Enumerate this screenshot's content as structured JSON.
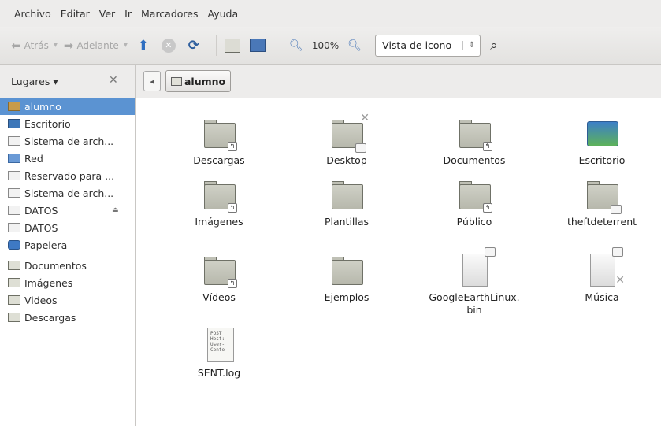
{
  "menubar": {
    "items": [
      {
        "label": "Archivo"
      },
      {
        "label": "Editar"
      },
      {
        "label": "Ver"
      },
      {
        "label": "Ir"
      },
      {
        "label": "Marcadores"
      },
      {
        "label": "Ayuda"
      }
    ]
  },
  "toolbar": {
    "back_label": "Atrás",
    "forward_label": "Adelante",
    "zoom_level": "100%",
    "view_mode": "Vista de icono",
    "icons": [
      "back-icon",
      "forward-icon",
      "up-icon",
      "stop-icon",
      "reload-icon",
      "home-icon",
      "computer-icon",
      "zoom-out-icon",
      "zoom-in-icon",
      "search-icon"
    ]
  },
  "sidebar": {
    "header_label": "Lugares",
    "items": [
      {
        "label": "alumno",
        "icon": "home-icon",
        "selected": true
      },
      {
        "label": "Escritorio",
        "icon": "desktop-icon"
      },
      {
        "label": "Sistema de arch...",
        "icon": "drive-icon"
      },
      {
        "label": "Red",
        "icon": "network-icon"
      },
      {
        "label": "Reservado para ...",
        "icon": "drive-icon"
      },
      {
        "label": "Sistema de arch...",
        "icon": "drive-icon"
      },
      {
        "label": "DATOS",
        "icon": "drive-icon",
        "eject": true
      },
      {
        "label": "DATOS",
        "icon": "drive-icon"
      },
      {
        "label": "Papelera",
        "icon": "trash-icon"
      },
      {
        "label": "Documentos",
        "icon": "folder-icon"
      },
      {
        "label": "Imágenes",
        "icon": "folder-icon"
      },
      {
        "label": "Videos",
        "icon": "folder-icon"
      },
      {
        "label": "Descargas",
        "icon": "folder-icon"
      }
    ]
  },
  "pathbar": {
    "current": "alumno"
  },
  "files": [
    {
      "name": "Descargas",
      "type": "folder",
      "emblem": "link"
    },
    {
      "name": "Desktop",
      "type": "folder",
      "emblem": "lock-x"
    },
    {
      "name": "Documentos",
      "type": "folder",
      "emblem": "link"
    },
    {
      "name": "Escritorio",
      "type": "desktop"
    },
    {
      "name": "Imágenes",
      "type": "folder",
      "emblem": "link"
    },
    {
      "name": "Plantillas",
      "type": "folder"
    },
    {
      "name": "Público",
      "type": "folder",
      "emblem": "link"
    },
    {
      "name": "theftdeterrent",
      "type": "folder",
      "emblem": "lock"
    },
    {
      "name": "Vídeos",
      "type": "folder",
      "emblem": "link"
    },
    {
      "name": "Ejemplos",
      "type": "folder"
    },
    {
      "name": "GoogleEarthLinux.\nbin",
      "type": "doc",
      "emblem": "lock"
    },
    {
      "name": "Música",
      "type": "doc",
      "emblem": "lock-x"
    },
    {
      "name": "SENT.log",
      "type": "log",
      "preview": "POST\nHost:\nUser-\nConte"
    }
  ],
  "colors": {
    "selection": "#5b93d2",
    "chrome": "#edeceb",
    "accent_blue": "#2f6fc1"
  }
}
